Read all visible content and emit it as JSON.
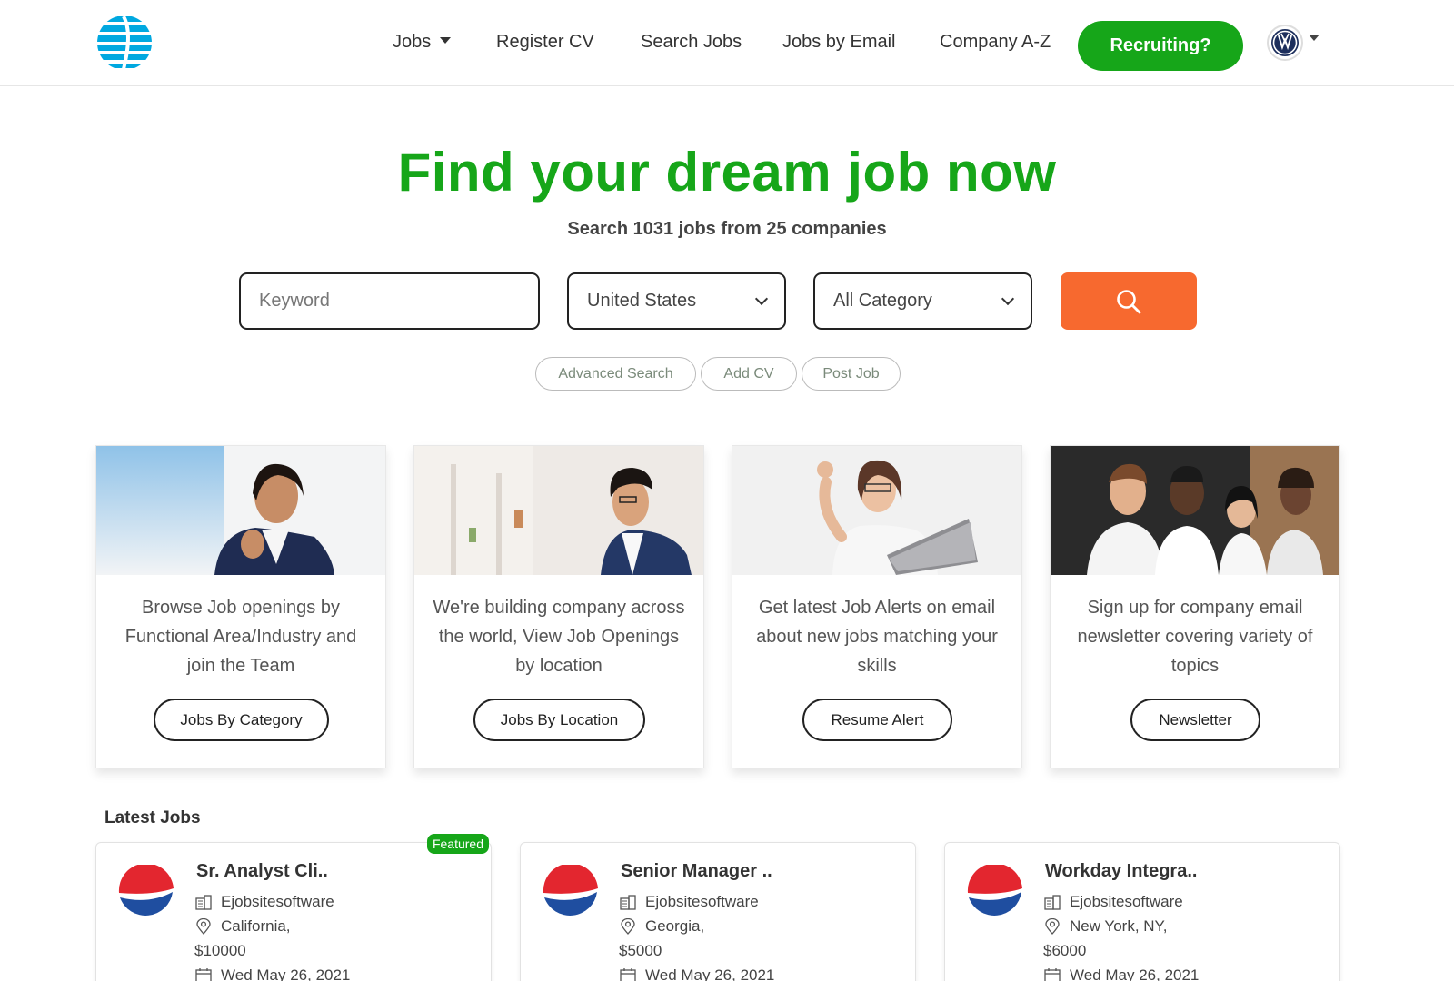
{
  "header": {
    "logo_name": "att-globe-logo",
    "nav": [
      {
        "label": "Jobs",
        "has_dropdown": true
      },
      {
        "label": "Register CV"
      },
      {
        "label": "Search Jobs"
      },
      {
        "label": "Jobs by Email"
      },
      {
        "label": "Company A-Z"
      }
    ],
    "recruit_label": "Recruiting?",
    "account_icon": "vw-logo-avatar"
  },
  "hero": {
    "title": "Find your dream job now",
    "subtitle": "Search 1031 jobs from 25 companies"
  },
  "search": {
    "keyword_placeholder": "Keyword",
    "keyword_value": "",
    "country_selected": "United States",
    "category_selected": "All Category",
    "search_icon": "search-icon"
  },
  "quick_links": [
    "Advanced Search",
    "Add CV",
    "Post Job"
  ],
  "features": [
    {
      "text": "Browse Job openings by Functional Area/Industry and join the Team",
      "button": "Jobs By Category"
    },
    {
      "text": "We're building company across the world, View Job Openings by location",
      "button": "Jobs By Location"
    },
    {
      "text": "Get latest Job Alerts on email about new jobs matching your skills",
      "button": "Resume Alert"
    },
    {
      "text": "Sign up for company email newsletter covering variety of topics",
      "button": "Newsletter"
    }
  ],
  "latest": {
    "title": "Latest Jobs",
    "jobs": [
      {
        "title": "Sr. Analyst Cli..",
        "company": "Ejobsitesoftware",
        "location": "California,",
        "salary": "$10000",
        "date": "Wed May 26, 2021",
        "badge": "Featured"
      },
      {
        "title": "Senior Manager ..",
        "company": "Ejobsitesoftware",
        "location": "Georgia,",
        "salary": "$5000",
        "date": "Wed May 26, 2021"
      },
      {
        "title": "Workday Integra..",
        "company": "Ejobsitesoftware",
        "location": "New York, NY,",
        "salary": "$6000",
        "date": "Wed May 26, 2021"
      }
    ]
  },
  "colors": {
    "brand_green": "#16a619",
    "search_orange": "#f7692f"
  }
}
